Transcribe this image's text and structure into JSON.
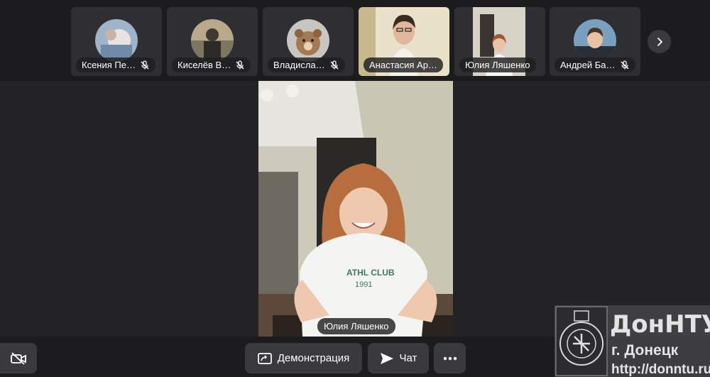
{
  "participants": [
    {
      "name": "Ксения Пе…",
      "muted": true,
      "mode": "avatar",
      "avatar": "avatar-ksenia"
    },
    {
      "name": "Киселёв В…",
      "muted": true,
      "mode": "avatar",
      "avatar": "avatar-kiselev"
    },
    {
      "name": "Владисла…",
      "muted": true,
      "mode": "avatar",
      "avatar": "avatar-vladislav"
    },
    {
      "name": "Анастасия Ар…",
      "muted": false,
      "mode": "video"
    },
    {
      "name": "Юлия Ляшенко",
      "muted": false,
      "mode": "video"
    },
    {
      "name": "Андрей Ба…",
      "muted": true,
      "mode": "avatar",
      "avatar": "avatar-andrey"
    }
  ],
  "main": {
    "speaker_name": "Юлия Ляшенко",
    "shirt_text_1": "ATHL CLUB",
    "shirt_text_2": "1991"
  },
  "controls": {
    "camera_icon": "camera-off-icon",
    "demo_label": "Демонстрация",
    "chat_label": "Чат",
    "more_icon": "more-icon"
  },
  "watermark": {
    "title": "ДонНТУ",
    "city": "г. Донецк",
    "url": "http://donntu.ru"
  },
  "colors": {
    "background": "#232325",
    "strip": "#1c1c1e",
    "button": "#3a3a3e"
  }
}
